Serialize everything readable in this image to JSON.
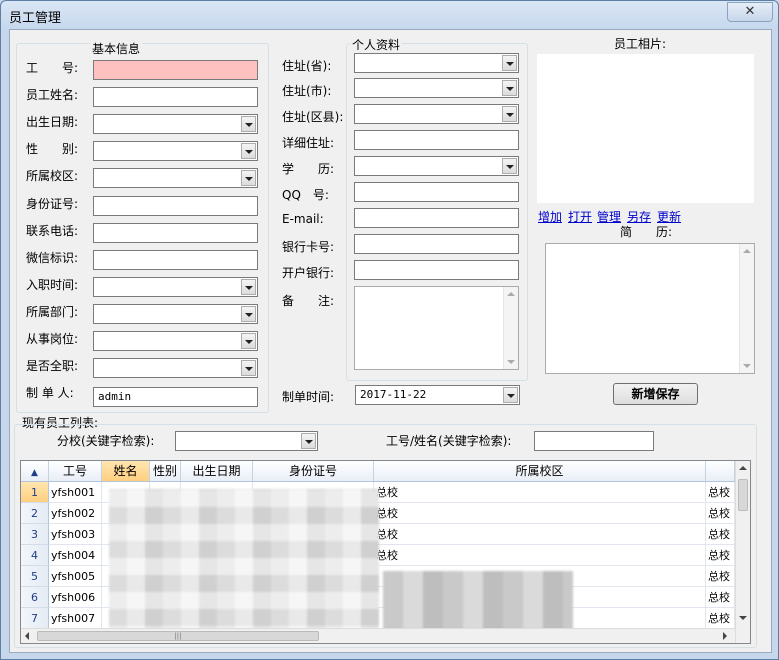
{
  "window": {
    "title": "员工管理",
    "close_glyph": "✕"
  },
  "basic_info": {
    "title": "基本信息",
    "fields": [
      {
        "label": "工　　号:",
        "type": "text",
        "value": ""
      },
      {
        "label": "员工姓名:",
        "type": "text",
        "value": ""
      },
      {
        "label": "出生日期:",
        "type": "combo",
        "value": ""
      },
      {
        "label": "性　　别:",
        "type": "combo",
        "value": ""
      },
      {
        "label": "所属校区:",
        "type": "combo",
        "value": ""
      },
      {
        "label": "身份证号:",
        "type": "text",
        "value": ""
      },
      {
        "label": "联系电话:",
        "type": "text",
        "value": ""
      },
      {
        "label": "微信标识:",
        "type": "text",
        "value": ""
      },
      {
        "label": "入职时间:",
        "type": "combo",
        "value": ""
      },
      {
        "label": "所属部门:",
        "type": "combo",
        "value": ""
      },
      {
        "label": "从事岗位:",
        "type": "combo",
        "value": ""
      },
      {
        "label": "是否全职:",
        "type": "combo",
        "value": ""
      }
    ],
    "creator_label": "制 单 人:",
    "creator_value": "admin"
  },
  "personal_info": {
    "title": "个人资料",
    "fields": [
      {
        "label": "住址(省):",
        "type": "combo",
        "value": ""
      },
      {
        "label": "住址(市):",
        "type": "combo",
        "value": ""
      },
      {
        "label": "住址(区县):",
        "type": "combo",
        "value": ""
      },
      {
        "label": "详细住址:",
        "type": "text",
        "value": ""
      },
      {
        "label": "学　　历:",
        "type": "combo",
        "value": ""
      },
      {
        "label": "QQ　号:",
        "type": "text",
        "value": ""
      },
      {
        "label": "E-mail:",
        "type": "text",
        "value": ""
      },
      {
        "label": "银行卡号:",
        "type": "text",
        "value": ""
      },
      {
        "label": "开户银行:",
        "type": "text",
        "value": ""
      }
    ],
    "remark_label": "备　　注:",
    "create_time_label": "制单时间:",
    "create_time_value": "2017-11-22"
  },
  "photo": {
    "title": "员工相片:",
    "links": [
      "增加",
      "打开",
      "管理",
      "另存",
      "更新"
    ],
    "resume_label": "简　　历:"
  },
  "save_button": "新增保存",
  "list": {
    "title": "现有员工列表:",
    "branch_filter_label": "分校(关键字检索):",
    "branch_filter_value": "",
    "id_filter_label": "工号/姓名(关键字检索):",
    "id_filter_value": "",
    "columns": [
      "工号",
      "姓名",
      "性别",
      "出生日期",
      "身份证号",
      "所属校区"
    ],
    "rows": [
      {
        "num": "1",
        "id": "yfsh001",
        "campus": "总校",
        "campus2": "总校"
      },
      {
        "num": "2",
        "id": "yfsh002",
        "campus": "总校",
        "campus2": "总校"
      },
      {
        "num": "3",
        "id": "yfsh003",
        "campus": "总校",
        "campus2": "总校"
      },
      {
        "num": "4",
        "id": "yfsh004",
        "campus": "总校",
        "campus2": "总校"
      },
      {
        "num": "5",
        "id": "yfsh005",
        "campus": "",
        "campus2": "总校"
      },
      {
        "num": "6",
        "id": "yfsh006",
        "campus": "",
        "campus2": "总校"
      },
      {
        "num": "7",
        "id": "yfsh007",
        "campus": "",
        "campus2": "总校"
      }
    ]
  },
  "colors": {
    "required_field": "#ffc0c0",
    "link": "#0000cc",
    "selected_header": "#ffcf80"
  }
}
